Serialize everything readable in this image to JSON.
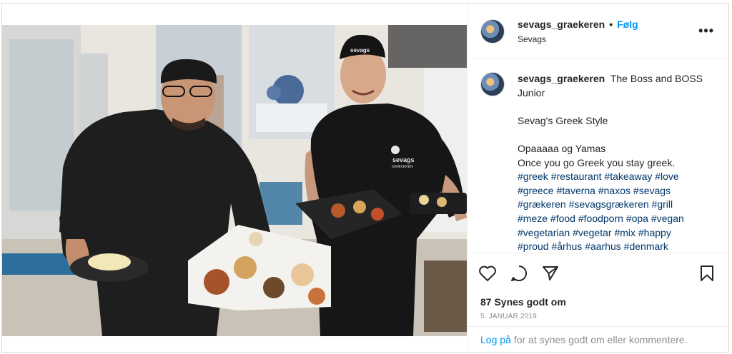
{
  "post": {
    "username": "sevags_graekeren",
    "follow_label": "Følg",
    "location": "Sevags",
    "more_label": "•••",
    "caption": {
      "username": "sevags_graekeren",
      "lines": [
        "The Boss and BOSS",
        "Junior",
        "",
        "Sevag's Greek Style",
        "",
        "Opaaaaa og Yamas",
        "Once you go Greek you stay greek."
      ],
      "hashtags": [
        "#greek",
        "#restaurant",
        "#takeaway",
        "#love",
        "#greece",
        "#taverna",
        "#naxos",
        "#sevags",
        "#grækeren",
        "#sevagsgrækeren",
        "#grill",
        "#meze",
        "#food",
        "#foodporn",
        "#opa",
        "#vegan",
        "#vegetarian",
        "#vegetar",
        "#mix",
        "#happy",
        "#proud",
        "#århus",
        "#aarhus",
        "#denmark"
      ]
    },
    "likes_text": "87 Synes godt om",
    "date_text": "5. JANUAR 2019",
    "login": {
      "link": "Log på",
      "rest": "for at synes godt om eller kommentere."
    }
  },
  "photo": {
    "apron_logo": "sevags",
    "apron_logo_sub": "GRÆKEREN",
    "cap_logo": "sevags"
  },
  "colors": {
    "link_blue": "#0095f6",
    "hashtag_blue": "#00376b",
    "muted": "#8e8e8e",
    "border": "#dbdbdb"
  }
}
